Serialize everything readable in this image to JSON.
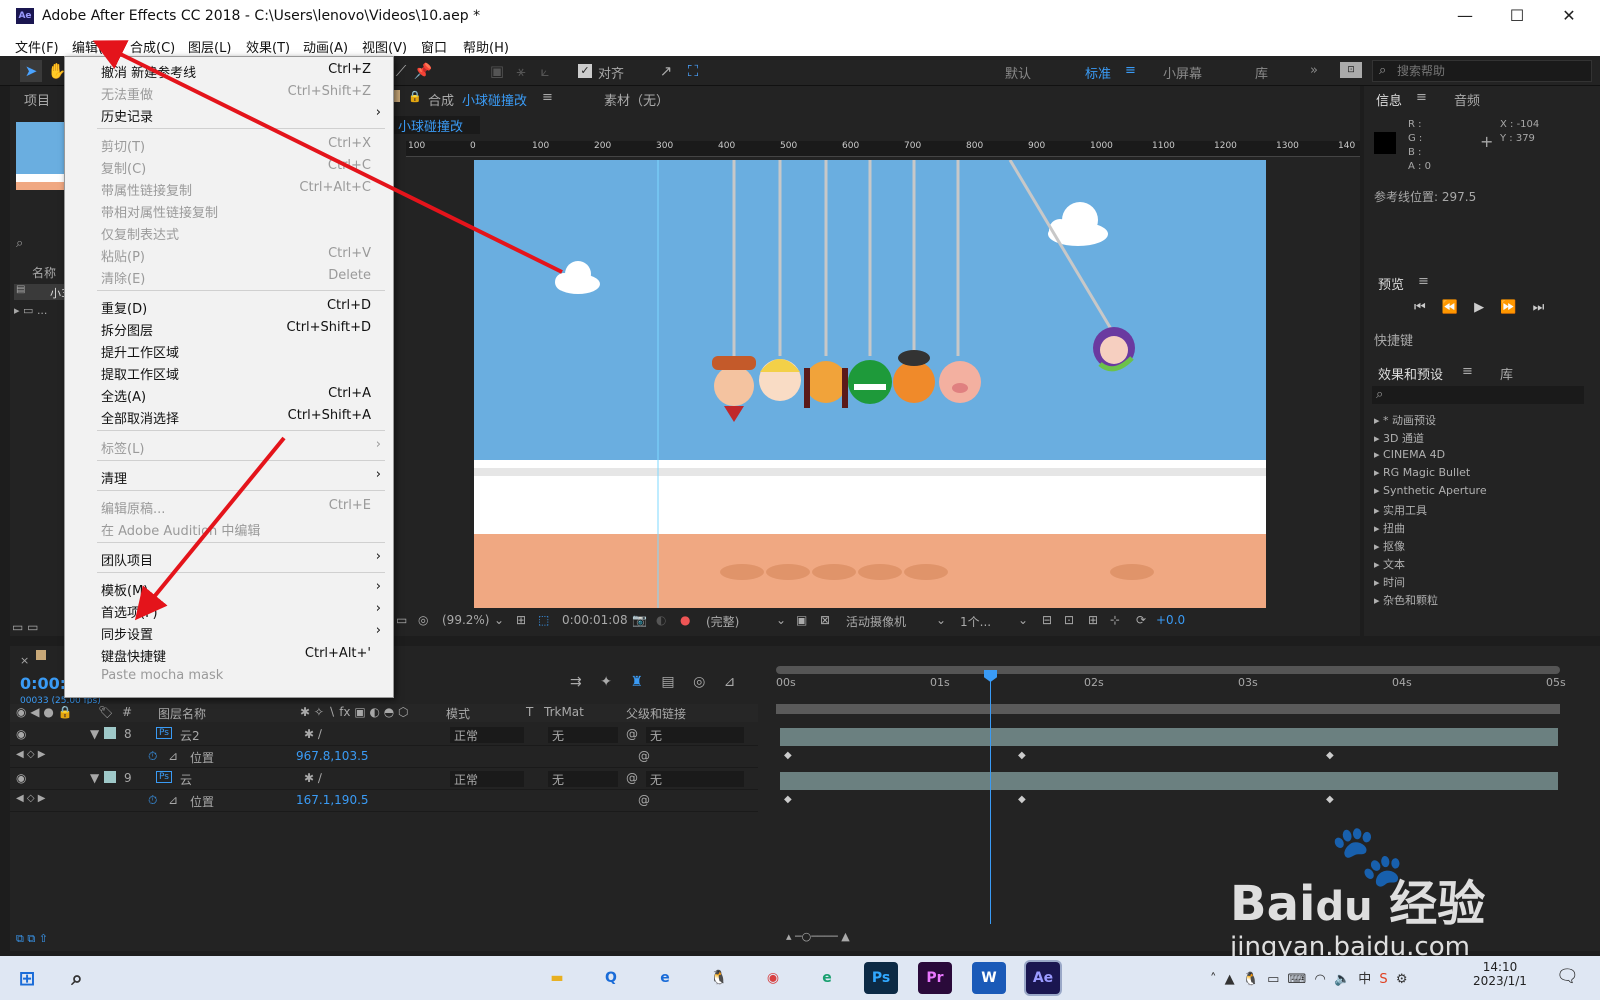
{
  "window": {
    "title": "Adobe After Effects CC 2018 - C:\\Users\\lenovo\\Videos\\10.aep *",
    "app_icon": "Ae"
  },
  "menubar": [
    "文件(F)",
    "编辑(E)",
    "合成(C)",
    "图层(L)",
    "效果(T)",
    "动画(A)",
    "视图(V)",
    "窗口",
    "帮助(H)"
  ],
  "toolbar": {
    "snap_label": "对齐",
    "workspaces": [
      "默认",
      "标准",
      "小屏幕",
      "库"
    ],
    "active_workspace": "标准",
    "search_placeholder": "搜索帮助"
  },
  "project": {
    "tab": "项目",
    "name_col": "名称",
    "item1": "小3",
    "item2": "..."
  },
  "composition": {
    "tab_prefix": "合成",
    "comp_name": "小球碰撞改",
    "footage_tab": "素材（无）",
    "breadcrumb": "小球碰撞改",
    "ruler_ticks": [
      "100",
      "0",
      "100",
      "200",
      "300",
      "400",
      "500",
      "600",
      "700",
      "800",
      "900",
      "1000",
      "1100",
      "1200",
      "1300",
      "140"
    ],
    "zoom": "(99.2%)",
    "time": "0:00:01:08",
    "quality": "(完整)",
    "camera": "活动摄像机",
    "views": "1个...",
    "exposure": "+0.0"
  },
  "info": {
    "tab": "信息",
    "audio_tab": "音频",
    "r": "R :",
    "g": "G :",
    "b": "B :",
    "a": "A : 0",
    "x": "X : -104",
    "y": "Y : 379",
    "guide": "参考线位置: 297.5"
  },
  "preview": {
    "tab": "预览",
    "shortcut": "快捷键"
  },
  "effects": {
    "tab": "效果和预设",
    "lib_tab": "库",
    "items": [
      "* 动画预设",
      "3D 通道",
      "CINEMA 4D",
      "RG Magic Bullet",
      "Synthetic Aperture",
      "实用工具",
      "扭曲",
      "抠像",
      "文本",
      "时间",
      "杂色和颗粒"
    ]
  },
  "timeline": {
    "timecode": "0:00:",
    "fps": "00033 (25.00 fps)",
    "col_name": "图层名称",
    "col_mode": "模式",
    "col_t": "T",
    "col_trkmat": "TrkMat",
    "col_parent": "父级和链接",
    "time_marks": [
      "00s",
      "01s",
      "02s",
      "03s",
      "04s",
      "05s"
    ],
    "layers": [
      {
        "num": "8",
        "name": "云2",
        "mode": "正常",
        "trk": "无",
        "parent": "无",
        "prop": "位置",
        "value": "967.8,103.5"
      },
      {
        "num": "9",
        "name": "云",
        "mode": "正常",
        "trk": "无",
        "parent": "无",
        "prop": "位置",
        "value": "167.1,190.5"
      }
    ]
  },
  "edit_menu": {
    "items": [
      {
        "label": "撤消 新建参考线",
        "shortcut": "Ctrl+Z"
      },
      {
        "label": "无法重做",
        "shortcut": "Ctrl+Shift+Z"
      },
      {
        "label": "历史记录",
        "shortcut": ""
      },
      {
        "label": "剪切(T)",
        "shortcut": "Ctrl+X"
      },
      {
        "label": "复制(C)",
        "shortcut": "Ctrl+C"
      },
      {
        "label": "带属性链接复制",
        "shortcut": "Ctrl+Alt+C"
      },
      {
        "label": "带相对属性链接复制",
        "shortcut": ""
      },
      {
        "label": "仅复制表达式",
        "shortcut": ""
      },
      {
        "label": "粘贴(P)",
        "shortcut": "Ctrl+V"
      },
      {
        "label": "清除(E)",
        "shortcut": "Delete"
      },
      {
        "label": "重复(D)",
        "shortcut": "Ctrl+D"
      },
      {
        "label": "拆分图层",
        "shortcut": "Ctrl+Shift+D"
      },
      {
        "label": "提升工作区域",
        "shortcut": ""
      },
      {
        "label": "提取工作区域",
        "shortcut": ""
      },
      {
        "label": "全选(A)",
        "shortcut": "Ctrl+A"
      },
      {
        "label": "全部取消选择",
        "shortcut": "Ctrl+Shift+A"
      },
      {
        "label": "标签(L)",
        "shortcut": ""
      },
      {
        "label": "清理",
        "shortcut": ""
      },
      {
        "label": "编辑原稿...",
        "shortcut": "Ctrl+E"
      },
      {
        "label": "在 Adobe Audition 中编辑",
        "shortcut": ""
      },
      {
        "label": "团队项目",
        "shortcut": ""
      },
      {
        "label": "模板(M)",
        "shortcut": ""
      },
      {
        "label": "首选项(F)",
        "shortcut": ""
      },
      {
        "label": "同步设置",
        "shortcut": ""
      },
      {
        "label": "键盘快捷键",
        "shortcut": "Ctrl+Alt+'"
      },
      {
        "label": "Paste mocha mask",
        "shortcut": ""
      }
    ]
  },
  "taskbar": {
    "apps": [
      "文件夹",
      "QQ浏览器",
      "Edge",
      "QQ",
      "Chrome",
      "Edge Dev",
      "Ps",
      "Pr",
      "W",
      "Ae"
    ],
    "ime": "中",
    "time": "14:10",
    "date": "2023/1/1"
  },
  "watermark": {
    "brand": "Bai",
    "brand2": "du",
    "cn": "经验",
    "url": "jingyan.baidu.com"
  },
  "colors": {
    "accent": "#3a9bf5",
    "sky": "#6aaee0",
    "arrow": "#e4141b"
  }
}
